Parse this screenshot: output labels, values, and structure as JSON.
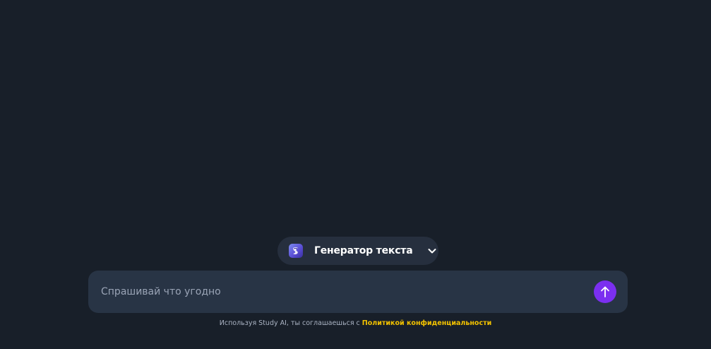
{
  "model_selector": {
    "label": "Генератор текста",
    "icon": "study-ai-logo-icon",
    "chevron_icon": "chevron-down-icon"
  },
  "chat_input": {
    "placeholder": "Спрашивай что угодно",
    "value": "",
    "send_icon": "arrow-up-icon"
  },
  "footer": {
    "prefix_text": "Используя Study AI, ты соглашаешься с ",
    "link_text": "Политикой конфиденциальности"
  },
  "colors": {
    "background": "#181f29",
    "selector_bg": "#262f3e",
    "input_bg": "#283445",
    "send_button": "#7b2ff0",
    "link": "#f2c200"
  }
}
